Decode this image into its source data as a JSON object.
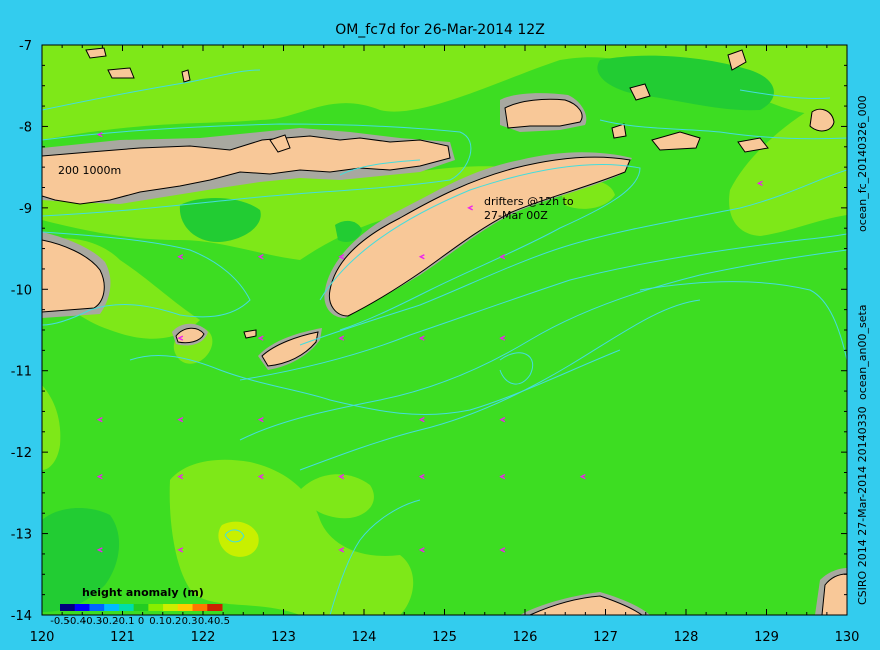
{
  "title": "OM_fc7d for 26-Mar-2014 12Z",
  "x_ticks": [
    "120",
    "121",
    "122",
    "123",
    "124",
    "125",
    "126",
    "127",
    "128",
    "129",
    "130"
  ],
  "y_ticks": [
    "-7",
    "-8",
    "-9",
    "-10",
    "-11",
    "-12",
    "-13",
    "-14"
  ],
  "side_labels": {
    "top": "ocean_fc_20140326_000",
    "middle": "ocean_an00_seta",
    "bottom": "CSIRO 2014   27-Mar-2014 20140330"
  },
  "annotations": {
    "isobath_label": "200  1000m",
    "drifters_line1": "drifters @12h to",
    "drifters_line2": "27-Mar 00Z"
  },
  "colorbar": {
    "title": "height anomaly (m)",
    "ticks": [
      "-0.5",
      "-0.4",
      "-0.3",
      "-0.2",
      "-0.1",
      "0",
      "0.1",
      "0.2",
      "0.3",
      "0.4",
      "0.5"
    ],
    "colors": [
      "#00007f",
      "#0000ff",
      "#0066ff",
      "#00bbff",
      "#00ddaa",
      "#22cc22",
      "#88ee00",
      "#ccee00",
      "#ffcc00",
      "#ff7700",
      "#cc2200"
    ]
  },
  "colors": {
    "background": "#33ccee",
    "sea_base": "#3ddd22",
    "sea_positive": "#7ee818",
    "sea_negative": "#22cc33",
    "land": "#f8c898",
    "shelf": "#a8a8a0",
    "contour": "#44dddd",
    "drifter": "#ee22ee"
  },
  "chart_data": {
    "type": "heatmap",
    "title": "OM_fc7d for 26-Mar-2014 12Z",
    "xlim": [
      120,
      130
    ],
    "ylim": [
      -14,
      -7
    ],
    "colorbar_label": "height anomaly (m)",
    "colorbar_range": [
      -0.5,
      0.5
    ],
    "drifters": [
      [
        120.7,
        -8.1
      ],
      [
        121.7,
        -9.6
      ],
      [
        122.7,
        -9.6
      ],
      [
        123.7,
        -9.6
      ],
      [
        124.7,
        -9.6
      ],
      [
        125.7,
        -9.6
      ],
      [
        121.7,
        -10.6
      ],
      [
        122.7,
        -10.6
      ],
      [
        123.7,
        -10.6
      ],
      [
        124.7,
        -10.6
      ],
      [
        125.7,
        -10.6
      ],
      [
        120.7,
        -11.6
      ],
      [
        121.7,
        -11.6
      ],
      [
        122.7,
        -11.6
      ],
      [
        124.7,
        -11.6
      ],
      [
        125.7,
        -11.6
      ],
      [
        120.7,
        -12.3
      ],
      [
        121.7,
        -12.3
      ],
      [
        122.7,
        -12.3
      ],
      [
        123.7,
        -12.3
      ],
      [
        124.7,
        -12.3
      ],
      [
        125.7,
        -12.3
      ],
      [
        126.7,
        -12.3
      ],
      [
        120.7,
        -13.2
      ],
      [
        121.7,
        -13.2
      ],
      [
        123.7,
        -13.2
      ],
      [
        124.7,
        -13.2
      ],
      [
        125.7,
        -13.2
      ],
      [
        125.3,
        -9.0
      ],
      [
        128.9,
        -8.7
      ]
    ]
  }
}
